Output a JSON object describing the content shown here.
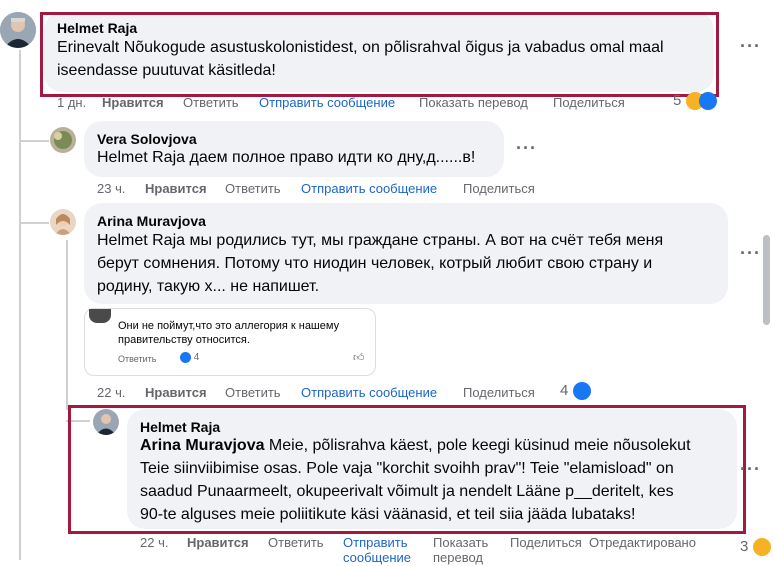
{
  "comments": [
    {
      "author": "Helmet Raja",
      "text_lines": [
        "Erinevalt Nõukogude asustuskolonistidest, on põlisrahval õigus ja vabadus omal maal",
        "iseendasse puutuvat käsitleda!"
      ],
      "time": "1 дн.",
      "like": "Нравится",
      "reply": "Ответить",
      "message": "Отправить сообщение",
      "translate": "Показать перевод",
      "share": "Поделиться",
      "reactions_count": "5"
    },
    {
      "author": "Vera Solovjova",
      "text": "Helmet Raja даем полное право идти ко дну,д......в!",
      "time": "23 ч.",
      "like": "Нравится",
      "reply": "Ответить",
      "message": "Отправить сообщение",
      "share": "Поделиться"
    },
    {
      "author": "Arina Muravjova",
      "text_lines": [
        "Helmet Raja мы родились тут, мы граждане страны. А вот на счёт тебя меня",
        "берут сомнения. Потому что ниодин человек, котрый любит свою страну и",
        "родину, такую х... не напишет."
      ],
      "embed": {
        "text_lines": [
          "Они не поймут,что это аллегория к нашему",
          "правительству относится."
        ],
        "reply": "Ответить",
        "likes": "4"
      },
      "time": "22 ч.",
      "like": "Нравится",
      "reply": "Ответить",
      "message": "Отправить сообщение",
      "share": "Поделиться",
      "reactions_count": "4"
    },
    {
      "author": "Helmet Raja",
      "mention": "Arina Muravjova",
      "text_first": " Meie, põlisrahva käest, pole keegi küsinud meie nõusolekut",
      "text_lines": [
        "Teie siinviibimise osas. Pole vaja \"korchit svoihh prav\"! Teie \"elamisload\" on",
        "saadud Punaarmeelt, okupeerivalt võimult ja nendelt Lääne p__deritelt, kes",
        "90-te alguses meie poliitikute käsi väänasid, et teil siia jääda lubataks!"
      ],
      "time": "22 ч.",
      "like": "Нравится",
      "reply": "Ответить",
      "message_line1": "Отправить",
      "message_line2": "сообщение",
      "translate_line1": "Показать",
      "translate_line2": "перевод",
      "share": "Поделиться",
      "edited": "Отредактировано",
      "reactions_count": "3"
    }
  ],
  "colors": {
    "highlight": "#a4193f",
    "link": "#1b66c9",
    "bubble": "#f0f2f5",
    "meta": "#65676b"
  }
}
